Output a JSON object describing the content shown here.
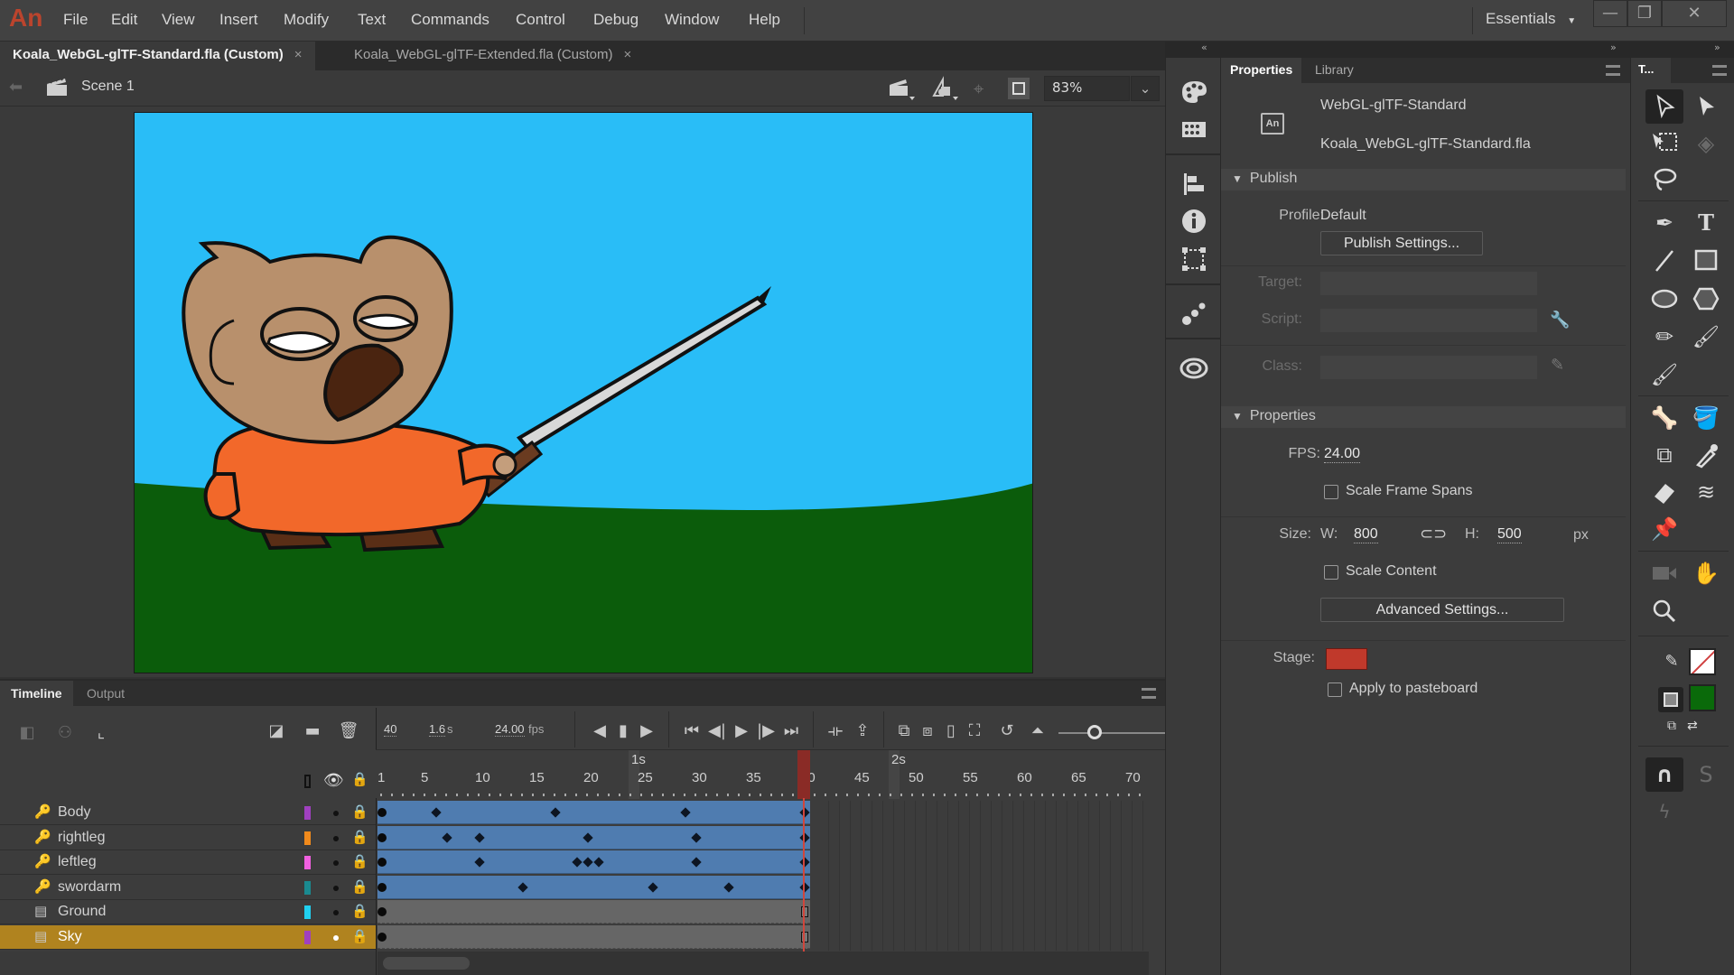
{
  "app": {
    "logo": "An",
    "menu": [
      "File",
      "Edit",
      "View",
      "Insert",
      "Modify",
      "Text",
      "Commands",
      "Control",
      "Debug",
      "Window",
      "Help"
    ],
    "workspace": "Essentials",
    "window_buttons": {
      "minimize": "—",
      "restore": "❐",
      "close": "✕"
    }
  },
  "doc_tabs": [
    {
      "label": "Koala_WebGL-glTF-Standard.fla (Custom)",
      "active": true,
      "close": "×"
    },
    {
      "label": "Koala_WebGL-glTF-Extended.fla (Custom)",
      "active": false,
      "close": "×"
    }
  ],
  "scene_bar": {
    "back_icon": "arrow-left-icon",
    "scene_label": "Scene 1",
    "zoom": "83%",
    "icons": [
      "edit-scene-icon",
      "edit-symbols-icon",
      "center-stage-icon",
      "clip-content-icon"
    ]
  },
  "stage": {
    "sky_color": "#29bdf7",
    "ground_color": "#0a5a0a"
  },
  "panel_strip": {
    "collapse_left": "«",
    "collapse_right": "»",
    "icons": [
      "color-icon",
      "swatches-icon",
      "align-icon",
      "info-icon",
      "transform-icon",
      "motion-presets-icon",
      "cc-libraries-icon"
    ]
  },
  "properties": {
    "tabs": [
      "Properties",
      "Library"
    ],
    "doc_type": "WebGL-glTF-Standard",
    "doc_file": "Koala_WebGL-glTF-Standard.fla",
    "publish": {
      "header": "Publish",
      "profile_label": "Profile:",
      "profile_value": "Default",
      "settings_button": "Publish Settings...",
      "target_label": "Target:",
      "script_label": "Script:",
      "class_label": "Class:"
    },
    "props": {
      "header": "Properties",
      "fps_label": "FPS:",
      "fps_value": "24.00",
      "scale_frame_spans": "Scale Frame Spans",
      "size_label": "Size:",
      "w_label": "W:",
      "w_value": "800",
      "h_label": "H:",
      "h_value": "500",
      "unit": "px",
      "scale_content": "Scale Content",
      "advanced_button": "Advanced Settings...",
      "stage_label": "Stage:",
      "stage_color": "#c0392b",
      "apply_pasteboard": "Apply to pasteboard"
    }
  },
  "tools": {
    "tab": "T...",
    "stroke_color": "none",
    "fill_color": "#0a6a0a"
  },
  "timeline": {
    "tabs": [
      "Timeline",
      "Output"
    ],
    "current_frame": "40",
    "elapsed": "1.6",
    "elapsed_unit": "s",
    "fps": "24.00",
    "fps_unit": "fps",
    "ruler_ticks": [
      "1",
      "5",
      "10",
      "15",
      "20",
      "25",
      "30",
      "35",
      "40",
      "45",
      "50",
      "55",
      "60",
      "65",
      "70"
    ],
    "seconds_markers": [
      "1s",
      "2s"
    ],
    "playhead_frame": 40,
    "total_frames": 40,
    "layers": [
      {
        "name": "Body",
        "type": "pose",
        "color": "#a040c0",
        "selected": false,
        "keyframes": [
          6,
          17,
          29
        ]
      },
      {
        "name": "rightleg",
        "type": "pose",
        "color": "#f08a1c",
        "selected": false,
        "keyframes": [
          7,
          10,
          20,
          30
        ]
      },
      {
        "name": "leftleg",
        "type": "pose",
        "color": "#f060e0",
        "selected": false,
        "keyframes": [
          10,
          19,
          20,
          21,
          30
        ]
      },
      {
        "name": "swordarm",
        "type": "pose",
        "color": "#1a8a90",
        "selected": false,
        "keyframes": [
          14,
          26,
          33
        ]
      },
      {
        "name": "Ground",
        "type": "normal",
        "color": "#20d0f0",
        "selected": false,
        "keyframes": []
      },
      {
        "name": "Sky",
        "type": "normal",
        "color": "#a040c0",
        "selected": true,
        "keyframes": []
      }
    ]
  }
}
